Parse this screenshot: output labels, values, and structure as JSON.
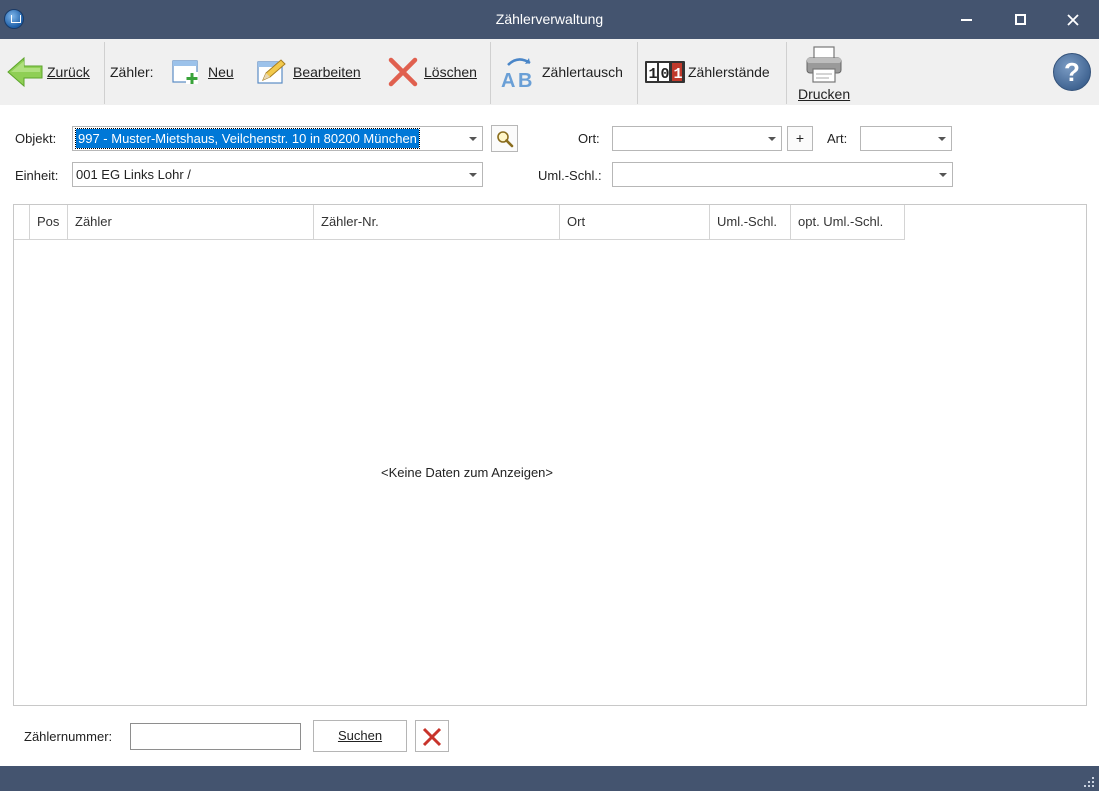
{
  "window": {
    "title": "Zählerverwaltung",
    "icons": {
      "app": "app-house-icon",
      "minimize": "minimize-icon",
      "maximize": "maximize-icon",
      "close": "close-icon"
    }
  },
  "toolbar": {
    "back_label": "Zurück",
    "zaehler_group_label": "Zähler:",
    "new_label": "Neu",
    "edit_label": "Bearbeiten",
    "delete_label": "Löschen",
    "swap_label": "Zählertausch",
    "readings_label": "Zählerstände",
    "readings_icon_text": "10",
    "readings_icon_digit": "1",
    "swap_icon_text": "AB",
    "print_label": "Drucken",
    "help_label": "?"
  },
  "filters": {
    "objekt_label": "Objekt:",
    "objekt_value": "997 - Muster-Mietshaus, Veilchenstr. 10 in 80200 München",
    "einheit_label": "Einheit:",
    "einheit_value": "001 EG Links Lohr /",
    "ort_label": "Ort:",
    "ort_value": "",
    "add_label": "+",
    "art_label": "Art:",
    "art_value": "",
    "uml_label": "Uml.-Schl.:",
    "uml_value": ""
  },
  "table": {
    "columns": [
      "Pos",
      "Zähler",
      "Zähler-Nr.",
      "Ort",
      "Uml.-Schl.",
      "opt. Uml.-Schl."
    ],
    "rows": [],
    "empty_text": "<Keine Daten zum Anzeigen>"
  },
  "search": {
    "label": "Zählernummer:",
    "value": "",
    "button_label": "Suchen"
  },
  "colors": {
    "titlebar": "#44546f",
    "selection": "#0078d7",
    "delete_red": "#c8332b",
    "back_green": "#7cc243"
  }
}
